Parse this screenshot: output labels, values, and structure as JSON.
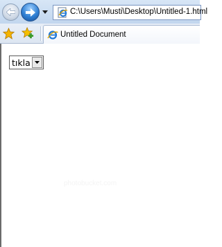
{
  "browser": {
    "address": "C:\\Users\\Musti\\Desktop\\Untitled-1.html",
    "tab_title": "Untitled Document",
    "icons": {
      "back": "back-arrow-icon",
      "forward": "forward-arrow-icon",
      "dropdown": "chevron-down-icon",
      "favorites": "star-icon",
      "add_favorites": "add-favorite-icon",
      "page": "ie-page-icon"
    }
  },
  "page": {
    "select": {
      "selected": "tıkla"
    },
    "watermark": "photobucket.com"
  },
  "colors": {
    "nav_bar": "#c9dbf0",
    "forward_button": "#2f7fd3",
    "star": "#f5b400",
    "add_favorite_plus": "#3a9a2a"
  }
}
